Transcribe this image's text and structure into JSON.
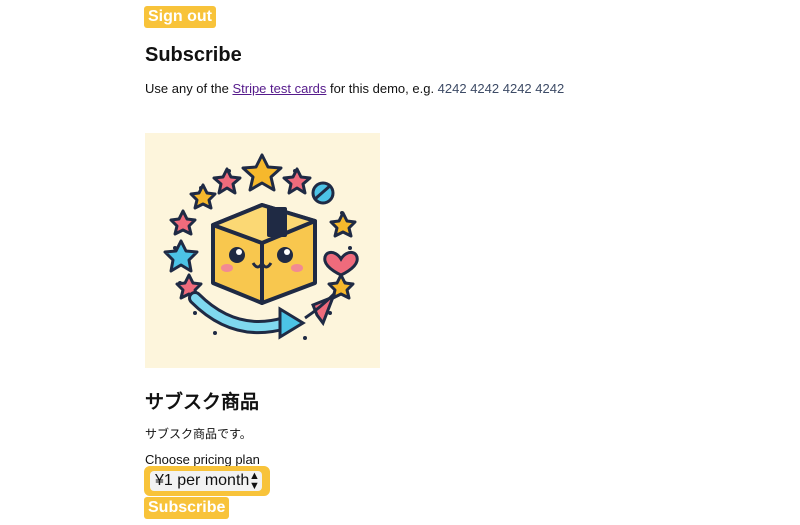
{
  "header": {
    "signout_label": "Sign out"
  },
  "main": {
    "title": "Subscribe",
    "note_prefix": "Use any of the ",
    "note_link": "Stripe test cards",
    "note_middle": " for this demo, e.g. ",
    "note_card": "4242 4242 4242 4242",
    "product": {
      "title": "サブスク商品",
      "description": "サブスク商品です。",
      "image_icon": "cute-box-with-stars-icon"
    },
    "plan": {
      "label": "Choose pricing plan",
      "selected": "¥1 per month"
    },
    "subscribe_label": "Subscribe"
  },
  "colors": {
    "accent": "#f8c33a",
    "link": "#551a8b",
    "image_bg": "#fdf5dc"
  }
}
